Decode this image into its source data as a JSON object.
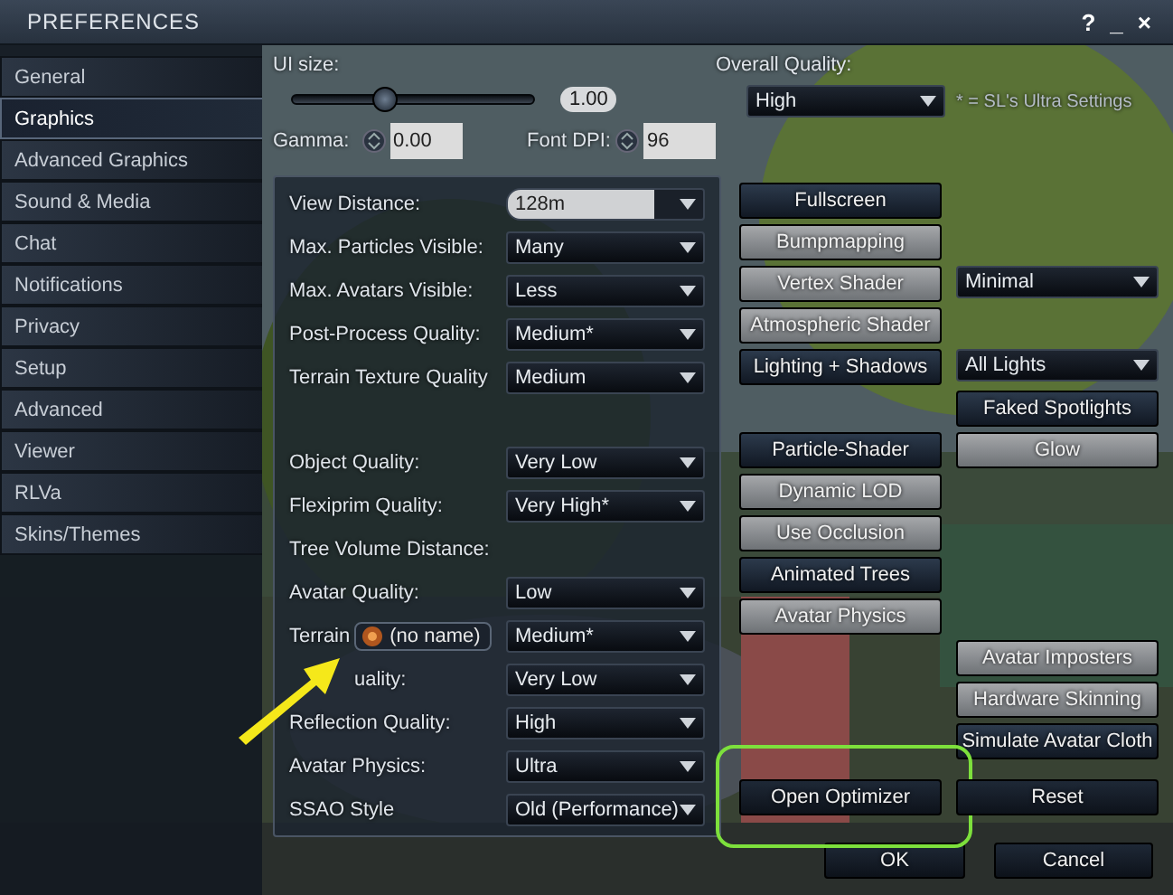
{
  "window": {
    "title": "PREFERENCES",
    "controls": [
      "?",
      "_",
      "×"
    ]
  },
  "sidebar": {
    "items": [
      {
        "label": "General",
        "selected": false
      },
      {
        "label": "Graphics",
        "selected": true
      },
      {
        "label": "Advanced Graphics",
        "selected": false
      },
      {
        "label": "Sound & Media",
        "selected": false
      },
      {
        "label": "Chat",
        "selected": false
      },
      {
        "label": "Notifications",
        "selected": false
      },
      {
        "label": "Privacy",
        "selected": false
      },
      {
        "label": "Setup",
        "selected": false
      },
      {
        "label": "Advanced",
        "selected": false
      },
      {
        "label": "Viewer",
        "selected": false
      },
      {
        "label": "RLVa",
        "selected": false
      },
      {
        "label": "Skins/Themes",
        "selected": false
      }
    ]
  },
  "ui_size": {
    "label": "UI size:",
    "level": 0.38,
    "value": "1.00"
  },
  "overall_quality": {
    "label": "Overall Quality:",
    "value": "High",
    "note": "* = SL's Ultra Settings"
  },
  "gamma": {
    "label": "Gamma:",
    "value": "0.00"
  },
  "font_dpi": {
    "label": "Font DPI:",
    "value": "96"
  },
  "display_settings": [
    {
      "label": "View Distance:",
      "value": "128m",
      "focused": true
    },
    {
      "label": "Max. Particles Visible:",
      "value": "Many",
      "focused": false
    },
    {
      "label": "Max. Avatars Visible:",
      "value": "Less",
      "focused": false
    },
    {
      "label": "Post-Process Quality:",
      "value": "Medium*",
      "focused": false
    },
    {
      "label": "Terrain Texture Quality",
      "value": "Medium",
      "focused": false
    }
  ],
  "quality_settings": [
    {
      "label": "Object Quality:",
      "value": "Very Low",
      "focused": false
    },
    {
      "label": "Flexiprim Quality:",
      "value": "Very High*",
      "focused": false
    },
    {
      "label": "Tree Volume Distance:"
    },
    {
      "label": "Avatar Quality:",
      "value": "Low",
      "focused": false
    },
    {
      "label": "Terrain",
      "value": "Medium*",
      "focused": false,
      "tooltip": "(no name)"
    },
    {
      "label": "uality:",
      "value": "Very Low",
      "focused": false,
      "arrow": true
    },
    {
      "label": "Reflection Quality:",
      "value": "High",
      "focused": false
    },
    {
      "label": "Avatar Physics:",
      "value": "Ultra",
      "focused": false
    },
    {
      "label": "SSAO Style",
      "value": "Old (Performance)",
      "focused": false
    }
  ],
  "toggles": [
    {
      "left": {
        "kind": "button",
        "label": "Fullscreen",
        "on": false
      }
    },
    {
      "left": {
        "kind": "button",
        "label": "Bumpmapping",
        "on": true
      }
    },
    {
      "left": {
        "kind": "button",
        "label": "Vertex Shader",
        "on": true
      },
      "right": {
        "kind": "dropdown",
        "value": "Minimal"
      }
    },
    {
      "left": {
        "kind": "button",
        "label": "Atmospheric Shader",
        "on": true
      }
    },
    {
      "left": {
        "kind": "button",
        "label": "Lighting + Shadows",
        "on": false
      },
      "right": {
        "kind": "dropdown",
        "value": "All Lights"
      }
    },
    {
      "right": {
        "kind": "button",
        "label": "Faked Spotlights",
        "on": false
      }
    },
    {
      "left": {
        "kind": "button",
        "label": "Particle-Shader",
        "on": false
      },
      "right": {
        "kind": "button",
        "label": "Glow",
        "on": true
      }
    },
    {
      "left": {
        "kind": "button",
        "label": "Dynamic LOD",
        "on": true
      }
    },
    {
      "left": {
        "kind": "button",
        "label": "Use Occlusion",
        "on": true
      }
    },
    {
      "left": {
        "kind": "button",
        "label": "Animated Trees",
        "on": false
      }
    },
    {
      "left": {
        "kind": "button",
        "label": "Avatar Physics",
        "on": true
      }
    },
    {
      "right": {
        "kind": "button",
        "label": "Avatar Imposters",
        "on": true
      }
    },
    {
      "right": {
        "kind": "button",
        "label": "Hardware Skinning",
        "on": true
      }
    },
    {
      "right": {
        "kind": "button",
        "label": "Simulate Avatar Cloth",
        "on": false
      }
    }
  ],
  "actions": [
    {
      "label": "Open Optimizer",
      "highlighted": true
    },
    {
      "label": "Reset",
      "highlighted": false
    }
  ],
  "dialog_buttons": [
    "OK",
    "Cancel"
  ]
}
